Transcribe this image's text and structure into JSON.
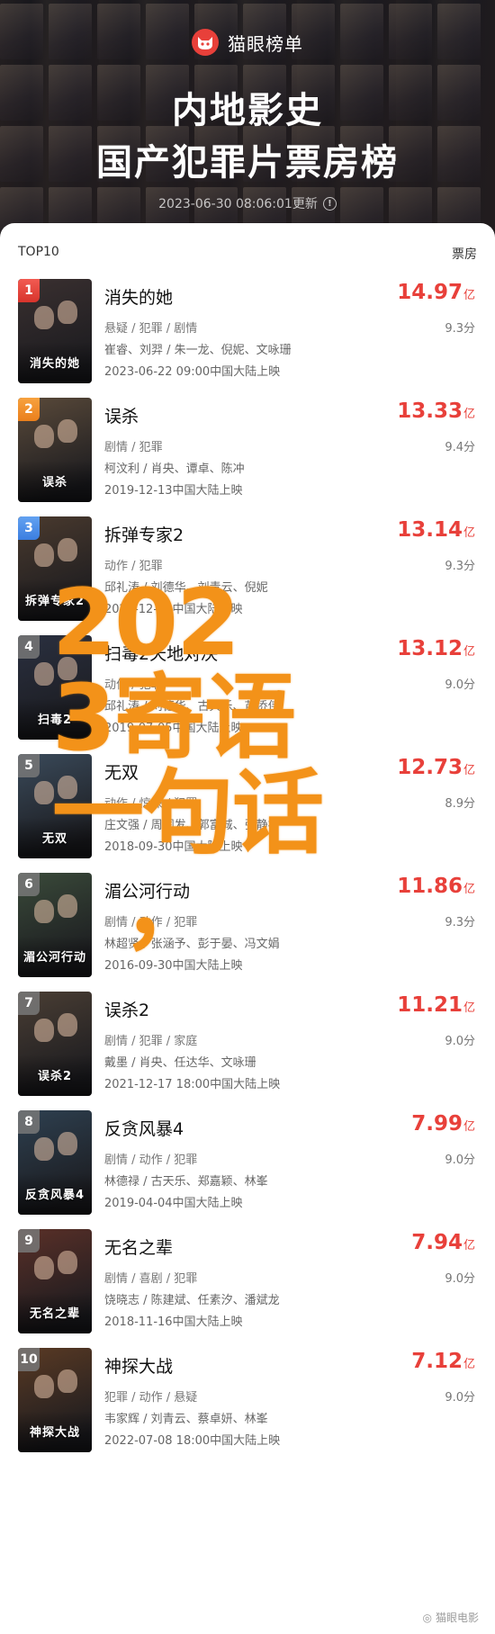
{
  "header": {
    "brand": "猫眼榜单",
    "title_line1": "内地影史",
    "title_line2": "国产犯罪片票房榜",
    "updated": "2023-06-30 08:06:01更新"
  },
  "list": {
    "label_left": "TOP10",
    "label_right": "票房",
    "items": [
      {
        "rank": "1",
        "title": "消失的她",
        "box": "14.97",
        "unit": "亿",
        "genre": "悬疑 / 犯罪 / 剧情",
        "score": "9.3分",
        "cast": "崔睿、刘羿 / 朱一龙、倪妮、文咏珊",
        "release": "2023-06-22 09:00中国大陆上映",
        "poster_text": "消失的她",
        "color": "#3a3030"
      },
      {
        "rank": "2",
        "title": "误杀",
        "box": "13.33",
        "unit": "亿",
        "genre": "剧情 / 犯罪",
        "score": "9.4分",
        "cast": "柯汶利 / 肖央、谭卓、陈冲",
        "release": "2019-12-13中国大陆上映",
        "poster_text": "误杀",
        "color": "#5a4a3a"
      },
      {
        "rank": "3",
        "title": "拆弹专家2",
        "box": "13.14",
        "unit": "亿",
        "genre": "动作 / 犯罪",
        "score": "9.3分",
        "cast": "邱礼涛 / 刘德华、刘青云、倪妮",
        "release": "2020-12-24中国大陆上映",
        "poster_text": "拆弹专家2",
        "color": "#4a3a2e"
      },
      {
        "rank": "4",
        "title": "扫毒2天地对决",
        "box": "13.12",
        "unit": "亿",
        "genre": "动作 / 犯罪",
        "score": "9.0分",
        "cast": "邱礼涛 / 刘德华、古天乐、苗侨伟",
        "release": "2019-07-05中国大陆上映",
        "poster_text": "扫毒2",
        "color": "#2a3040"
      },
      {
        "rank": "5",
        "title": "无双",
        "box": "12.73",
        "unit": "亿",
        "genre": "动作 / 惊悚 / 犯罪",
        "score": "8.9分",
        "cast": "庄文强 / 周润发、郭富城、张静初",
        "release": "2018-09-30中国大陆上映",
        "poster_text": "无双",
        "color": "#3a4a5a"
      },
      {
        "rank": "6",
        "title": "湄公河行动",
        "box": "11.86",
        "unit": "亿",
        "genre": "剧情 / 动作 / 犯罪",
        "score": "9.3分",
        "cast": "林超贤 / 张涵予、彭于晏、冯文娟",
        "release": "2016-09-30中国大陆上映",
        "poster_text": "湄公河行动",
        "color": "#3a4a3a"
      },
      {
        "rank": "7",
        "title": "误杀2",
        "box": "11.21",
        "unit": "亿",
        "genre": "剧情 / 犯罪 / 家庭",
        "score": "9.0分",
        "cast": "戴墨 / 肖央、任达华、文咏珊",
        "release": "2021-12-17 18:00中国大陆上映",
        "poster_text": "误杀2",
        "color": "#4a3e34"
      },
      {
        "rank": "8",
        "title": "反贪风暴4",
        "box": "7.99",
        "unit": "亿",
        "genre": "剧情 / 动作 / 犯罪",
        "score": "9.0分",
        "cast": "林德禄 / 古天乐、郑嘉颖、林峯",
        "release": "2019-04-04中国大陆上映",
        "poster_text": "反贪风暴4",
        "color": "#2e4050"
      },
      {
        "rank": "9",
        "title": "无名之辈",
        "box": "7.94",
        "unit": "亿",
        "genre": "剧情 / 喜剧 / 犯罪",
        "score": "9.0分",
        "cast": "饶晓志 / 陈建斌、任素汐、潘斌龙",
        "release": "2018-11-16中国大陆上映",
        "poster_text": "无名之辈",
        "color": "#5a3028"
      },
      {
        "rank": "10",
        "title": "神探大战",
        "box": "7.12",
        "unit": "亿",
        "genre": "犯罪 / 动作 / 悬疑",
        "score": "9.0分",
        "cast": "韦家辉 / 刘青云、蔡卓妍、林峯",
        "release": "2022-07-08 18:00中国大陆上映",
        "poster_text": "神探大战",
        "color": "#5a3a24"
      }
    ]
  },
  "overlay": {
    "line1": "202",
    "line2": "3寄语",
    "line3": "一句话",
    "line4": "，"
  },
  "watermark": "猫眼电影"
}
